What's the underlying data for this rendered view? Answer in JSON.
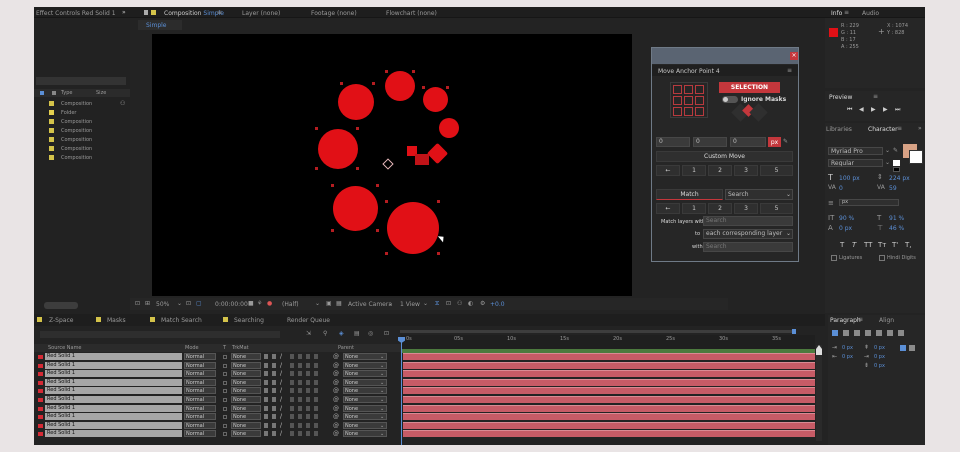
{
  "effect_controls_tab": "Effect Controls Red Solid 1",
  "comp_tab": {
    "label": "Composition",
    "name": "Simple"
  },
  "layer_tab": "Layer (none)",
  "footage_tab": "Footage (none)",
  "flowchart_tab": "Flowchart (none)",
  "info_tab": "Info",
  "audio_tab": "Audio",
  "comp_subtab": "Simple",
  "info": {
    "r": "R : 229",
    "g": "G : 11",
    "b": "B : 17",
    "a": "A : 255",
    "x": "X : 1074",
    "y": "Y : 828"
  },
  "project_columns": [
    "Type",
    "Size"
  ],
  "project_items": [
    "Composition",
    "Folder",
    "Composition",
    "Composition",
    "Composition",
    "Composition",
    "Composition"
  ],
  "viewer_bar": {
    "zoom": "50%",
    "time": "0:00:00:00",
    "quality": "(Half)",
    "camera": "Active Camera",
    "views": "1 View",
    "exposure": "+0.0"
  },
  "bottom_tabs": [
    "Z-Space",
    "Masks",
    "Match Search",
    "Searching",
    "Render Queue"
  ],
  "preview": {
    "title": "Preview"
  },
  "libraries_tab": "Libraries",
  "character_tab": "Character",
  "character": {
    "font": "Myriad Pro",
    "style": "Regular",
    "size": "100 px",
    "leading": "224 px",
    "kerning": "0",
    "tracking": "59",
    "unit": "px",
    "vscale": "90 %",
    "hscale": "91 %",
    "baseline": "0 px",
    "tsume": "46 %",
    "ligatures": "Ligatures",
    "hindi": "Hindi Digits",
    "style_buttons": [
      "T",
      "T",
      "TT",
      "Tт",
      "T'",
      "T,"
    ]
  },
  "paragraph_tab": "Paragraph",
  "align_tab": "Align",
  "paragraph": {
    "v1": "0 px",
    "v2": "0 px",
    "v3": "0 px",
    "v4": "0 px",
    "v5": "0 px"
  },
  "plugin": {
    "title": "Move Anchor Point 4",
    "selection": "SELECTION",
    "ignore_masks": "Ignore Masks",
    "x": "0",
    "y": "0",
    "z": "0",
    "unit": "px",
    "custom_move": "Custom Move",
    "row1": [
      "←",
      "1",
      "2",
      "3",
      "5"
    ],
    "match": "Match",
    "search_select": "Search",
    "row2": [
      "←",
      "1",
      "2",
      "3",
      "5"
    ],
    "match_label": "Match layers with",
    "match_placeholder": "Search",
    "to_label": "to",
    "to_value": "each corresponding layer",
    "with_label": "with",
    "with_placeholder": "Search"
  },
  "timeline_headers": {
    "source": "Source Name",
    "mode": "Mode",
    "t": "T",
    "trkmat": "TrkMat",
    "parent": "Parent"
  },
  "layers": [
    {
      "name": "Red Solid 1",
      "mode": "Normal",
      "trk": "None",
      "parent": "None"
    },
    {
      "name": "Red Solid 1",
      "mode": "Normal",
      "trk": "None",
      "parent": "None"
    },
    {
      "name": "Red Solid 1",
      "mode": "Normal",
      "trk": "None",
      "parent": "None"
    },
    {
      "name": "Red Solid 1",
      "mode": "Normal",
      "trk": "None",
      "parent": "None"
    },
    {
      "name": "Red Solid 1",
      "mode": "Normal",
      "trk": "None",
      "parent": "None"
    },
    {
      "name": "Red Solid 1",
      "mode": "Normal",
      "trk": "None",
      "parent": "None"
    },
    {
      "name": "Red Solid 1",
      "mode": "Normal",
      "trk": "None",
      "parent": "None"
    },
    {
      "name": "Red Solid 1",
      "mode": "Normal",
      "trk": "None",
      "parent": "None"
    },
    {
      "name": "Red Solid 1",
      "mode": "Normal",
      "trk": "None",
      "parent": "None"
    },
    {
      "name": "Red Solid 1",
      "mode": "Normal",
      "trk": "None",
      "parent": "None"
    }
  ],
  "ruler": [
    "0s",
    "05s",
    "10s",
    "15s",
    "20s",
    "25s",
    "30s",
    "35s"
  ],
  "colors": {
    "accent": "#e11016",
    "selection_button": "#c4373c",
    "label_red": "#d52a35",
    "track_bar": "#c75b66",
    "blue_ui": "#5b8fd6"
  }
}
